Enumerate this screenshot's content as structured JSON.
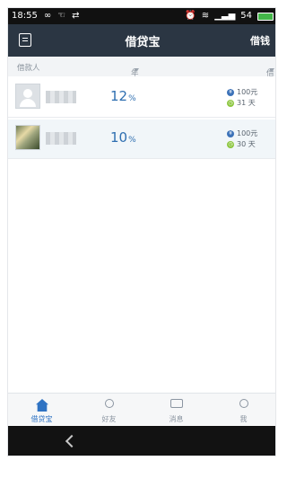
{
  "status": {
    "time": "18:55",
    "signal": "54"
  },
  "header": {
    "title": "借贷宝",
    "action": "借钱"
  },
  "columns": {
    "borrower": "借款人",
    "rate": "年利率",
    "amount": "借款/期限"
  },
  "loans": [
    {
      "rate": "12",
      "pct": "%",
      "amount": "100元",
      "term": "31 天"
    },
    {
      "rate": "10",
      "pct": "%",
      "amount": "100元",
      "term": "30 天"
    }
  ],
  "icons": {
    "yen": "¥",
    "clock": "◷"
  },
  "tabs": [
    {
      "label": "借贷宝"
    },
    {
      "label": "好友"
    },
    {
      "label": "消息"
    },
    {
      "label": "我"
    }
  ],
  "colors": {
    "header": "#2b3643",
    "accent": "#2f73c3",
    "rate": "#2f6fb1",
    "term_icon": "#8cc63f"
  }
}
